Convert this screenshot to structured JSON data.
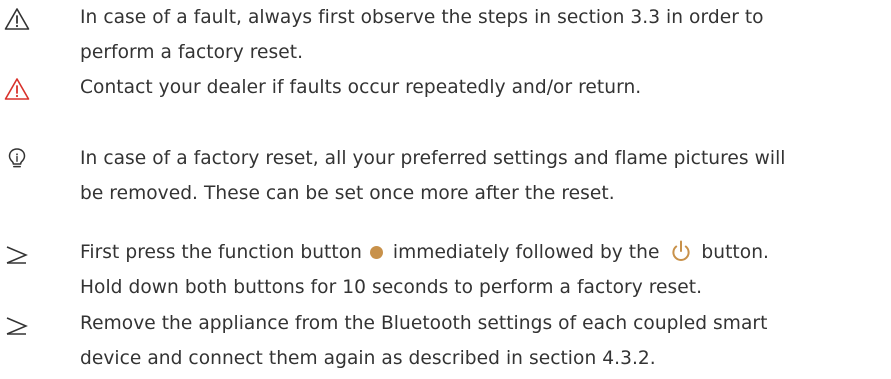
{
  "notes": [
    {
      "icon": "warning-outline-icon",
      "lines": [
        "In case of a fault, always first observe the steps in section 3.3 in order to",
        "perform a factory reset."
      ]
    },
    {
      "icon": "warning-red-icon",
      "lines": [
        "Contact your dealer if faults occur repeatedly and/or return."
      ]
    },
    {
      "icon": "lightbulb-icon",
      "lines": [
        "In case of a factory reset, all your preferred settings and flame pictures will",
        "be removed. These can be set once more after the reset."
      ]
    }
  ],
  "steps": [
    {
      "icon": "arrow-right-icon",
      "line1_before": "First press the function button ",
      "line1_middle": " immediately followed by the ",
      "line1_after": " button.",
      "line2": "Hold down both buttons for 10 seconds to perform a factory reset."
    },
    {
      "icon": "arrow-right-icon",
      "lines": [
        "Remove the appliance from the Bluetooth settings of each coupled smart",
        "device and connect them again as described in section 4.3.2."
      ]
    }
  ],
  "colors": {
    "text": "#333333",
    "warning_red": "#d9312b",
    "accent_gold": "#c8914a"
  }
}
